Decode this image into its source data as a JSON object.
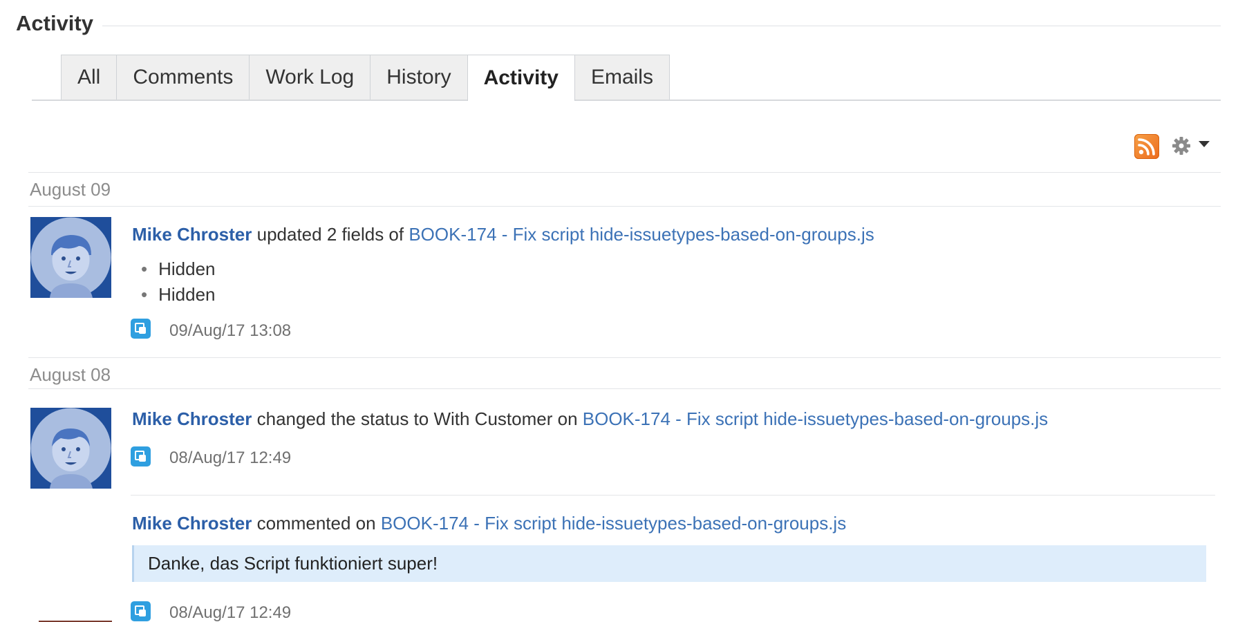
{
  "section": {
    "title": "Activity"
  },
  "tabs": [
    {
      "label": "All",
      "active": false
    },
    {
      "label": "Comments",
      "active": false
    },
    {
      "label": "Work Log",
      "active": false
    },
    {
      "label": "History",
      "active": false
    },
    {
      "label": "Activity",
      "active": true
    },
    {
      "label": "Emails",
      "active": false
    }
  ],
  "toolbar": {
    "rss_icon": "rss-icon",
    "settings_icon": "gear-icon",
    "menu_icon": "chevron-down-icon",
    "rss_color": "#f08a32"
  },
  "colors": {
    "user_link": "#2c5fa8",
    "issue_link": "#3c72b6",
    "comment_bg": "#deedfb",
    "avatar_bg": "#1f4e9b",
    "source_icon": "#2f9fe0"
  },
  "feed": [
    {
      "date": "August 09",
      "entries": [
        {
          "user": "Mike Chroster",
          "action": " updated 2 fields of ",
          "issue": "BOOK-174 - Fix script hide-issuetypes-based-on-groups.js",
          "fields": [
            "Hidden",
            "Hidden"
          ],
          "timestamp": "09/Aug/17 13:08"
        }
      ]
    },
    {
      "date": "August 08",
      "entries": [
        {
          "user": "Mike Chroster",
          "action": " changed the status to With Customer on ",
          "issue": "BOOK-174 - Fix script hide-issuetypes-based-on-groups.js",
          "timestamp": "08/Aug/17 12:49"
        },
        {
          "user": "Mike Chroster",
          "action": " commented on ",
          "issue": "BOOK-174 - Fix script hide-issuetypes-based-on-groups.js",
          "comment": "Danke, das Script funktioniert super!",
          "timestamp": "08/Aug/17 12:49"
        }
      ]
    }
  ]
}
